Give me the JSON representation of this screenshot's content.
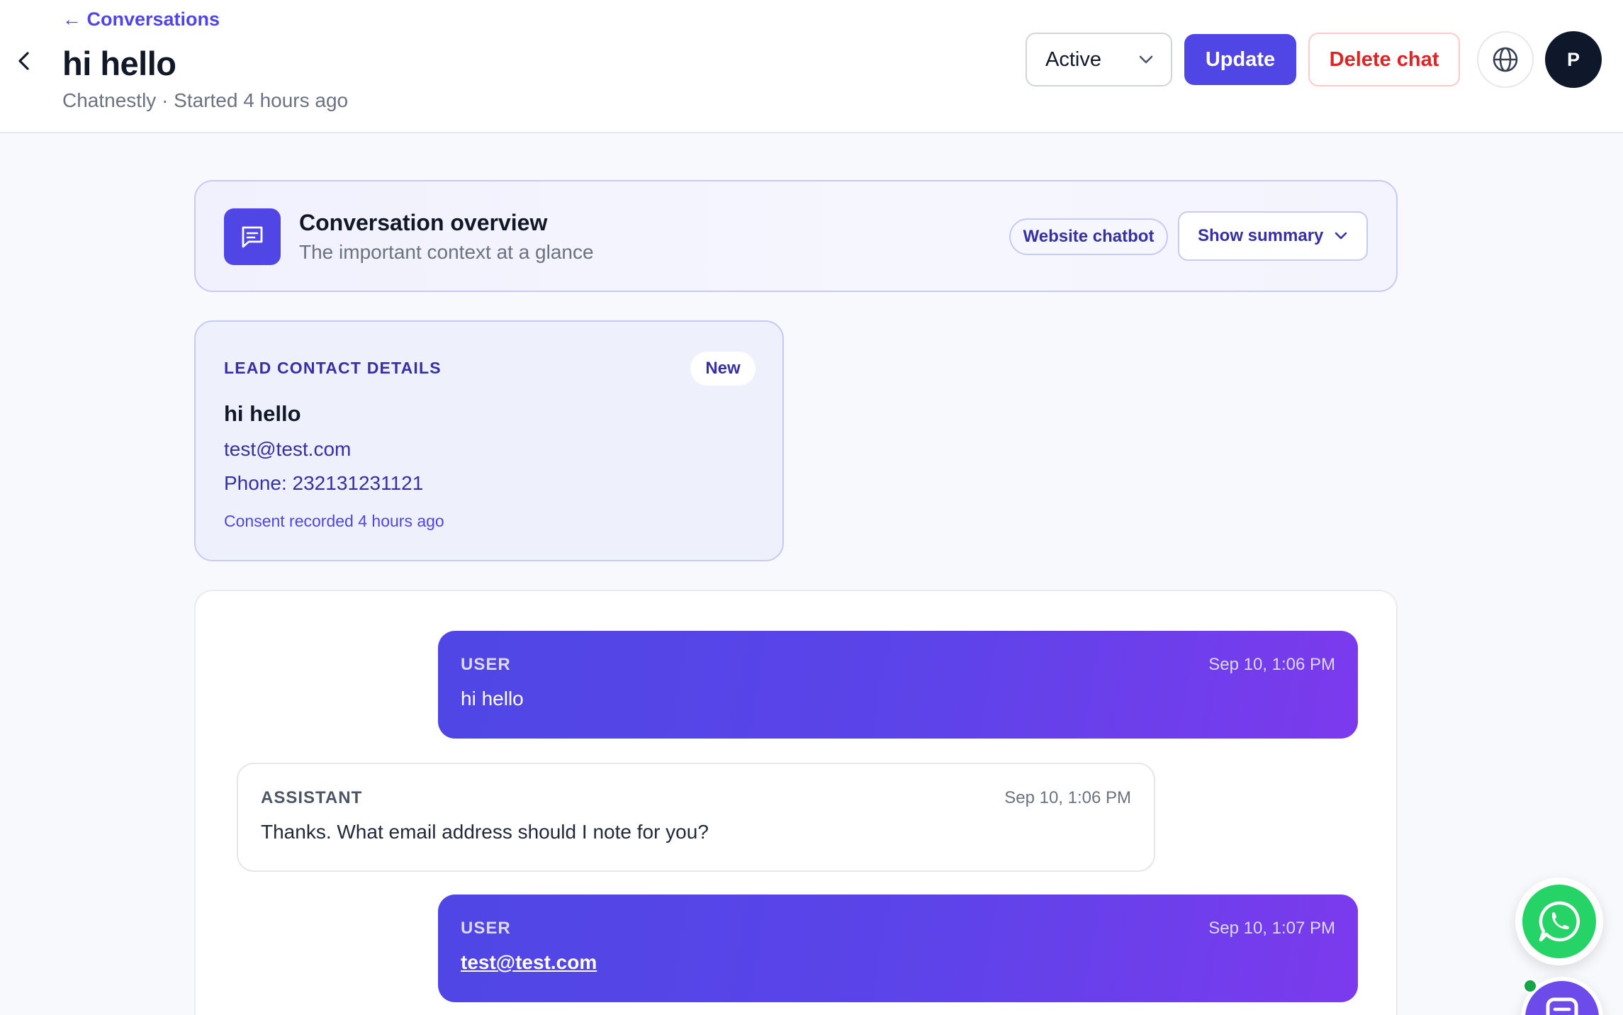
{
  "header": {
    "breadcrumb": "← Conversations",
    "title": "hi hello",
    "subtitle": "Chatnestly · Started 4 hours ago",
    "status_value": "Active",
    "update_label": "Update",
    "delete_label": "Delete chat",
    "avatar_initial": "P"
  },
  "overview": {
    "title": "Conversation overview",
    "subtitle": "The important context at a glance",
    "channel": "Website chatbot",
    "summary_label": "Show summary"
  },
  "lead": {
    "heading": "LEAD CONTACT DETAILS",
    "badge": "New",
    "name": "hi hello",
    "email": "test@test.com",
    "phone": "Phone: 232131231121",
    "consent": "Consent recorded 4 hours ago"
  },
  "messages": [
    {
      "role": "USER",
      "time": "Sep 10, 1:06 PM",
      "text": "hi hello"
    },
    {
      "role": "ASSISTANT",
      "time": "Sep 10, 1:06 PM",
      "text": "Thanks. What email address should I note for you?"
    },
    {
      "role": "USER",
      "time": "Sep 10, 1:07 PM",
      "text": "test@test.com"
    }
  ],
  "colors": {
    "accent": "#4f46e5",
    "danger": "#dc2626",
    "whatsapp": "#25d366",
    "avatar_bg": "#0f172a"
  },
  "icons": {
    "back": "chevron-left-icon",
    "dropdown": "chevron-down-icon",
    "globe": "globe-icon",
    "overview": "message-square-icon",
    "whatsapp": "whatsapp-icon",
    "chat_widget": "chat-bubble-icon"
  }
}
